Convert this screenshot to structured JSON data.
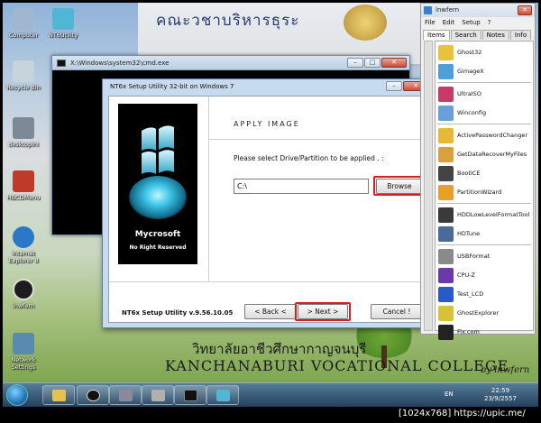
{
  "desktop": {
    "background_sign_text": "คณะวชาบริหารธุระ",
    "college_name_th": "วิทยาลัยอาชีวศึกษากาญจนบุรี",
    "college_name_en": "KANCHANABURI VOCATIONAL COLLEGE",
    "byline": "by lnwfern",
    "icons": [
      {
        "label": "Computer",
        "color": "#9fb7cf"
      },
      {
        "label": "NT6Utility",
        "color": "#4fb6d6"
      },
      {
        "label": "Recycle Bin",
        "color": "#c8d4dc"
      },
      {
        "label": "desktopini",
        "color": "#7c8a98"
      },
      {
        "label": "HBCDMenu",
        "color": "#c03a2a"
      },
      {
        "label": "Internet Explorer 8",
        "color": "#2a78c8"
      },
      {
        "label": "lnwfern",
        "color": "#1c1c1c"
      },
      {
        "label": "Network Settings",
        "color": "#5a8ab0"
      }
    ]
  },
  "cmd_window": {
    "title": "X:\\Windows\\system32\\cmd.exe"
  },
  "setup_dialog": {
    "title": "NT6x Setup Utility 32-bit on Windows 7",
    "brand": "Mycrosoft",
    "rights": "No Right Reserved",
    "heading": "APPLY IMAGE",
    "prompt": "Please select Drive/Partition to be applied . :",
    "path_value": "C:\\",
    "browse_label": "Browse",
    "footer": "NT6x Setup Utility v.9.56.10.05",
    "back_label": "< Back <",
    "next_label": "> Next >",
    "cancel_label": "Cancel !",
    "highlight_color": "#d42020"
  },
  "inwfern_panel": {
    "title": "lnwfern",
    "menu": [
      "File",
      "Edit",
      "Setup",
      "?"
    ],
    "tabs": [
      "Items",
      "Search",
      "Notes",
      "Info"
    ],
    "active_tab": "Items",
    "items": [
      {
        "label": "Ghost32",
        "color": "#e8c23a"
      },
      {
        "label": "GimageX",
        "color": "#4f9fd8"
      },
      {
        "label": "UltraISO",
        "color": "#c83a6a"
      },
      {
        "label": "Winconfig",
        "color": "#6aa0d8"
      },
      {
        "label": "ActivePasswordChanger",
        "color": "#e8b83a"
      },
      {
        "label": "GetDataRecoverMyFiles",
        "color": "#d8a23a"
      },
      {
        "label": "BootICE",
        "color": "#444444"
      },
      {
        "label": "PartitionWizard",
        "color": "#e8a02a"
      },
      {
        "label": "HDDLowLevelFormatTool",
        "color": "#3a3a3a"
      },
      {
        "label": "HDTune",
        "color": "#4a6a9a"
      },
      {
        "label": "USBFormat",
        "color": "#8a8a8a"
      },
      {
        "label": "CPU-Z",
        "color": "#6a3aa8"
      },
      {
        "label": "Test_LCD",
        "color": "#2a5ac8"
      },
      {
        "label": "GhostExplorer",
        "color": "#d8c23a"
      },
      {
        "label": "Fix.com",
        "color": "#222222"
      }
    ]
  },
  "taskbar": {
    "language": "EN",
    "time": "22:59",
    "date": "23/9/2557"
  },
  "caption": "[1024x768] https://upic.me/"
}
